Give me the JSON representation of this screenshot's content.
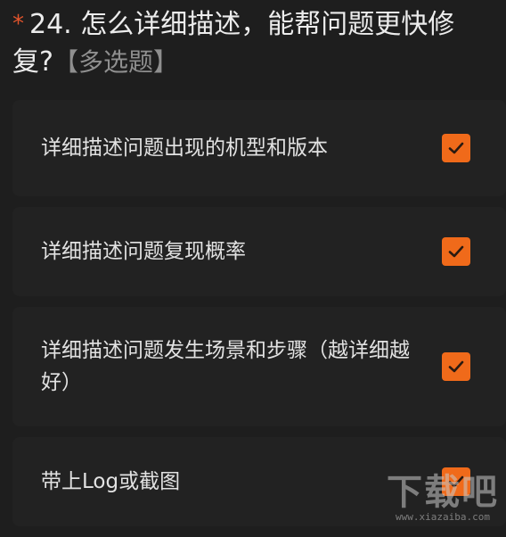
{
  "question": {
    "required_mark": "*",
    "title": "24. 怎么详细描述，能帮问题更快修复?",
    "type_label": "【多选题】"
  },
  "options": [
    {
      "label": "详细描述问题出现的机型和版本",
      "checked": true
    },
    {
      "label": "详细描述问题复现概率",
      "checked": true
    },
    {
      "label": "详细描述问题发生场景和步骤（越详细越好）",
      "checked": true
    },
    {
      "label": "带上Log或截图",
      "checked": true
    }
  ],
  "watermark": {
    "logo": "下载吧",
    "url": "www.xiazaiba.com"
  },
  "colors": {
    "background": "#1e1e1e",
    "card": "#222222",
    "accent": "#f06a1a",
    "required": "#e2542c"
  },
  "icons": {
    "checkbox": "check-icon"
  }
}
